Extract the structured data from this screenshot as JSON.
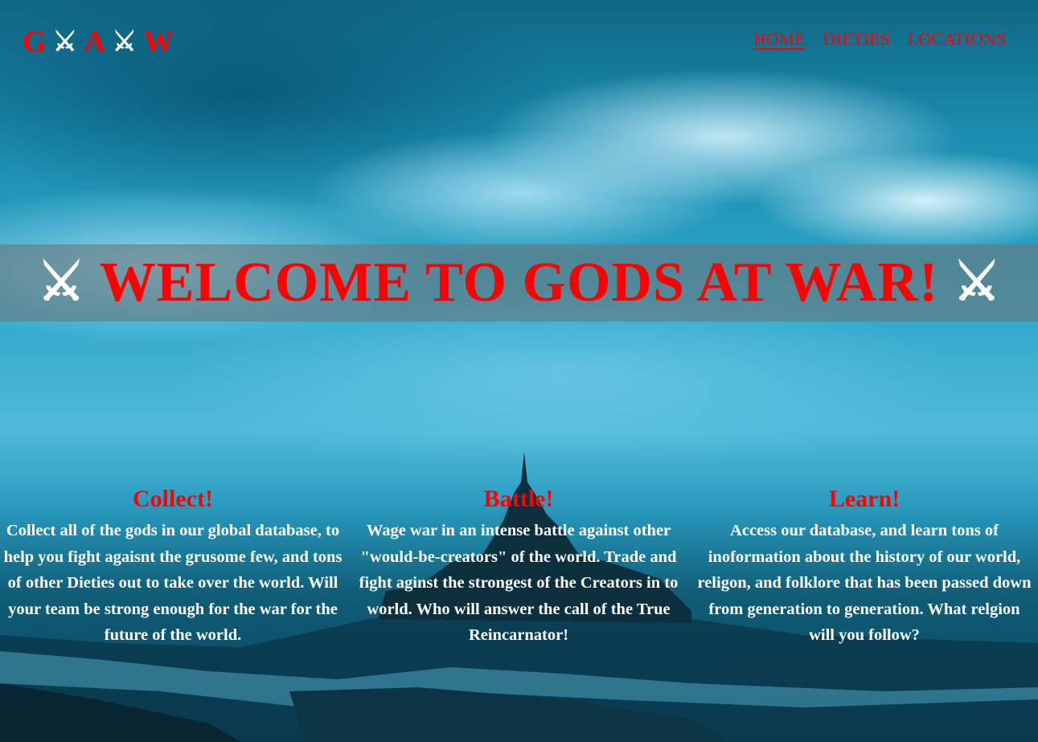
{
  "header": {
    "logo": {
      "letters": [
        "G",
        "A",
        "W"
      ],
      "separator_icon": "crossed-swords-icon",
      "separator_glyph": "⚔"
    },
    "nav": [
      {
        "label": "HOME",
        "active": true
      },
      {
        "label": "DIETIES",
        "active": false
      },
      {
        "label": "LOCATIONS",
        "active": false
      }
    ]
  },
  "hero": {
    "title": "WELCOME TO GODS AT WAR!",
    "icon": "crossed-swords-icon",
    "icon_glyph": "⚔"
  },
  "features": [
    {
      "title": "Collect!",
      "text": "Collect all of the gods in our global database, to help you fight agaisnt the grusome few, and tons of other Dieties out to take over the world. Will your team be strong enough for the war for the future of the world."
    },
    {
      "title": "Battle!",
      "text": "Wage war in an intense battle against other \"would-be-creators\" of the world. Trade and fight aginst the strongest of the Creators in to world. Who will answer the call of the True Reincarnator!"
    },
    {
      "title": "Learn!",
      "text": "Access our database, and learn tons of inoformation about the history of our world, religon, and folklore that has been passed down from generation to generation. What relgion will you follow?"
    }
  ],
  "colors": {
    "accent": "#ff0000",
    "text": "#ffffff",
    "banner_bg": "rgba(105,120,125,0.62)"
  }
}
